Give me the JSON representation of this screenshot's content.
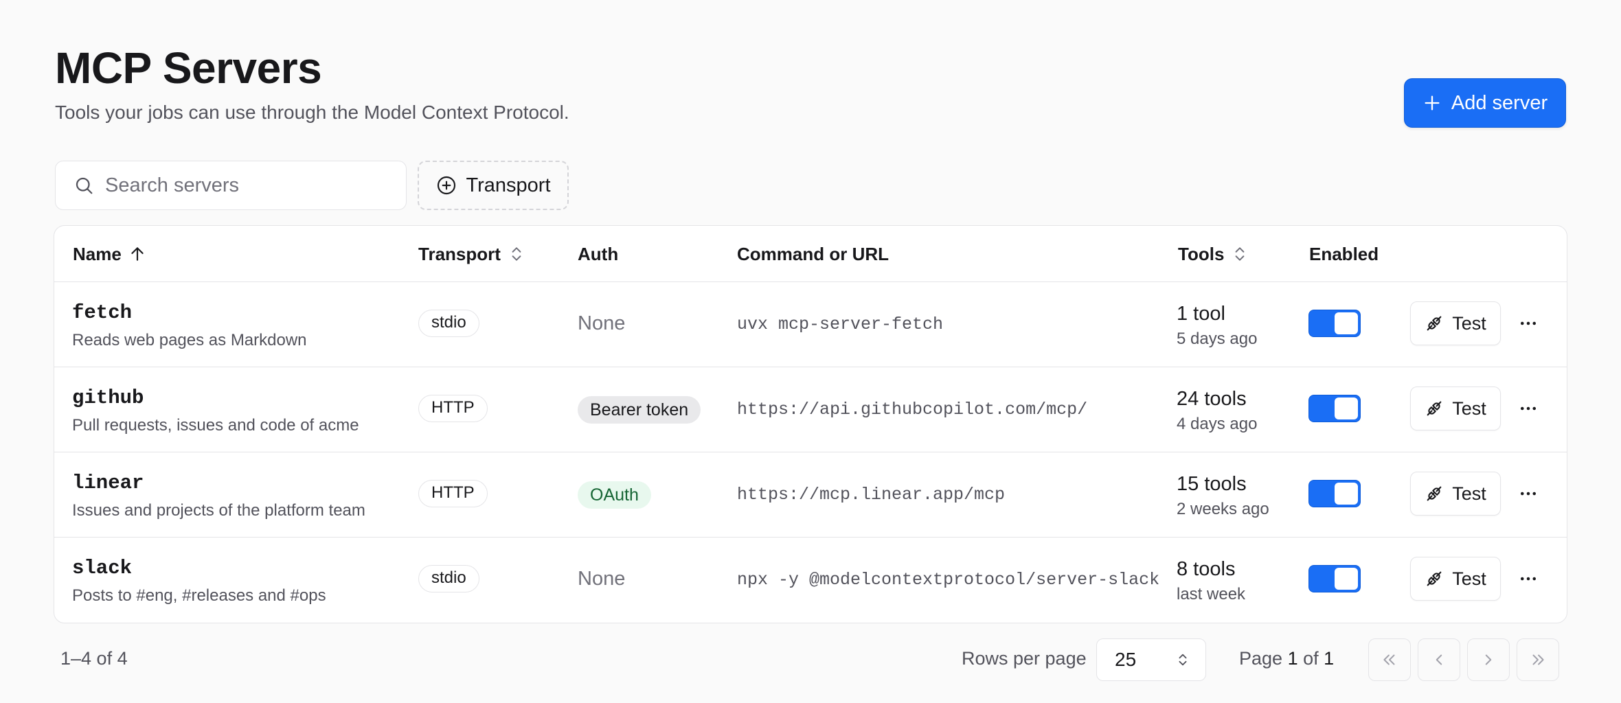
{
  "header": {
    "title": "MCP Servers",
    "subtitle": "Tools your jobs can use through the Model Context Protocol.",
    "add_button_label": "Add server",
    "accent_color": "#1a6ef5"
  },
  "toolbar": {
    "search_placeholder": "Search servers",
    "search_value": "",
    "transport_filter_label": "Transport"
  },
  "table": {
    "columns": {
      "name": "Name",
      "transport": "Transport",
      "auth": "Auth",
      "command": "Command or URL",
      "tools": "Tools",
      "enabled": "Enabled"
    },
    "sort": {
      "column": "name",
      "direction": "ascending"
    },
    "rows": [
      {
        "name": "fetch",
        "description": "Reads web pages as Markdown",
        "transport": "stdio",
        "auth": "None",
        "auth_style": "none",
        "command": "uvx mcp-server-fetch",
        "tools": "1 tool",
        "updated": "5 days ago",
        "enabled": true,
        "test_label": "Test"
      },
      {
        "name": "github",
        "description": "Pull requests, issues and code of acme",
        "transport": "HTTP",
        "auth": "Bearer token",
        "auth_style": "bearer",
        "command": "https://api.githubcopilot.com/mcp/",
        "tools": "24 tools",
        "updated": "4 days ago",
        "enabled": true,
        "test_label": "Test"
      },
      {
        "name": "linear",
        "description": "Issues and projects of the platform team",
        "transport": "HTTP",
        "auth": "OAuth",
        "auth_style": "oauth",
        "command": "https://mcp.linear.app/mcp",
        "tools": "15 tools",
        "updated": "2 weeks ago",
        "enabled": true,
        "test_label": "Test"
      },
      {
        "name": "slack",
        "description": "Posts to #eng, #releases and #ops",
        "transport": "stdio",
        "auth": "None",
        "auth_style": "none",
        "command": "npx -y @modelcontextprotocol/server-slack",
        "tools": "8 tools",
        "updated": "last week",
        "enabled": true,
        "test_label": "Test"
      }
    ]
  },
  "footer": {
    "count": "1–4 of 4",
    "rows_per_page_label": "Rows per page",
    "rows_per_page_value": "25",
    "page_label": "Page",
    "page_current": "1",
    "page_of": "of",
    "page_total": "1"
  }
}
